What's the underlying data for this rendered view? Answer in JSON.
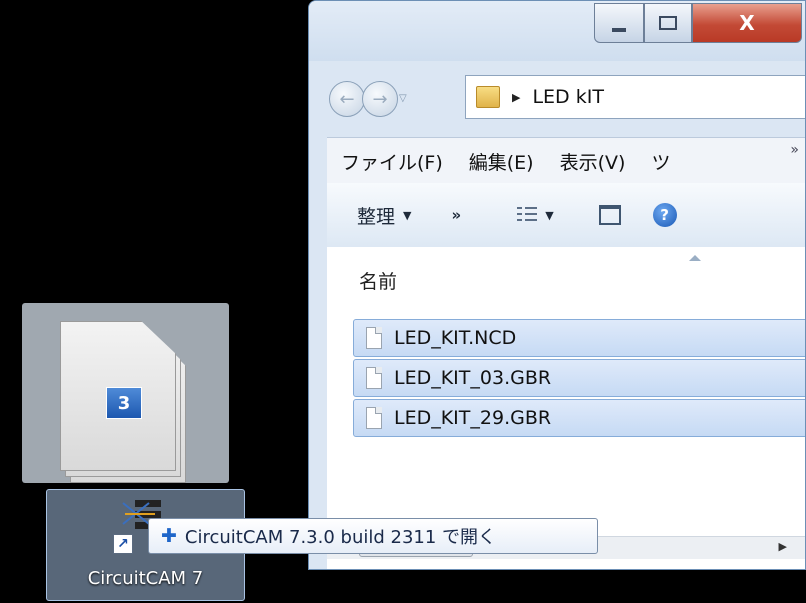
{
  "window": {
    "caption_buttons": {
      "close": "X"
    },
    "address": {
      "path": "LED kIT"
    },
    "menu": [
      "ファイル(F)",
      "編集(E)",
      "表示(V)",
      "ツ"
    ],
    "menu_overflow": "»",
    "toolbar": {
      "organize": "整理",
      "more": "»"
    },
    "column_header": "名前",
    "files": [
      "LED_KIT.NCD",
      "LED_KIT_03.GBR",
      "LED_KIT_29.GBR"
    ]
  },
  "drag": {
    "item_count": "3"
  },
  "shortcut": {
    "label": "CircuitCAM 7"
  },
  "tooltip": {
    "text": "CircuitCAM 7.3.0 build 2311 で開く"
  }
}
